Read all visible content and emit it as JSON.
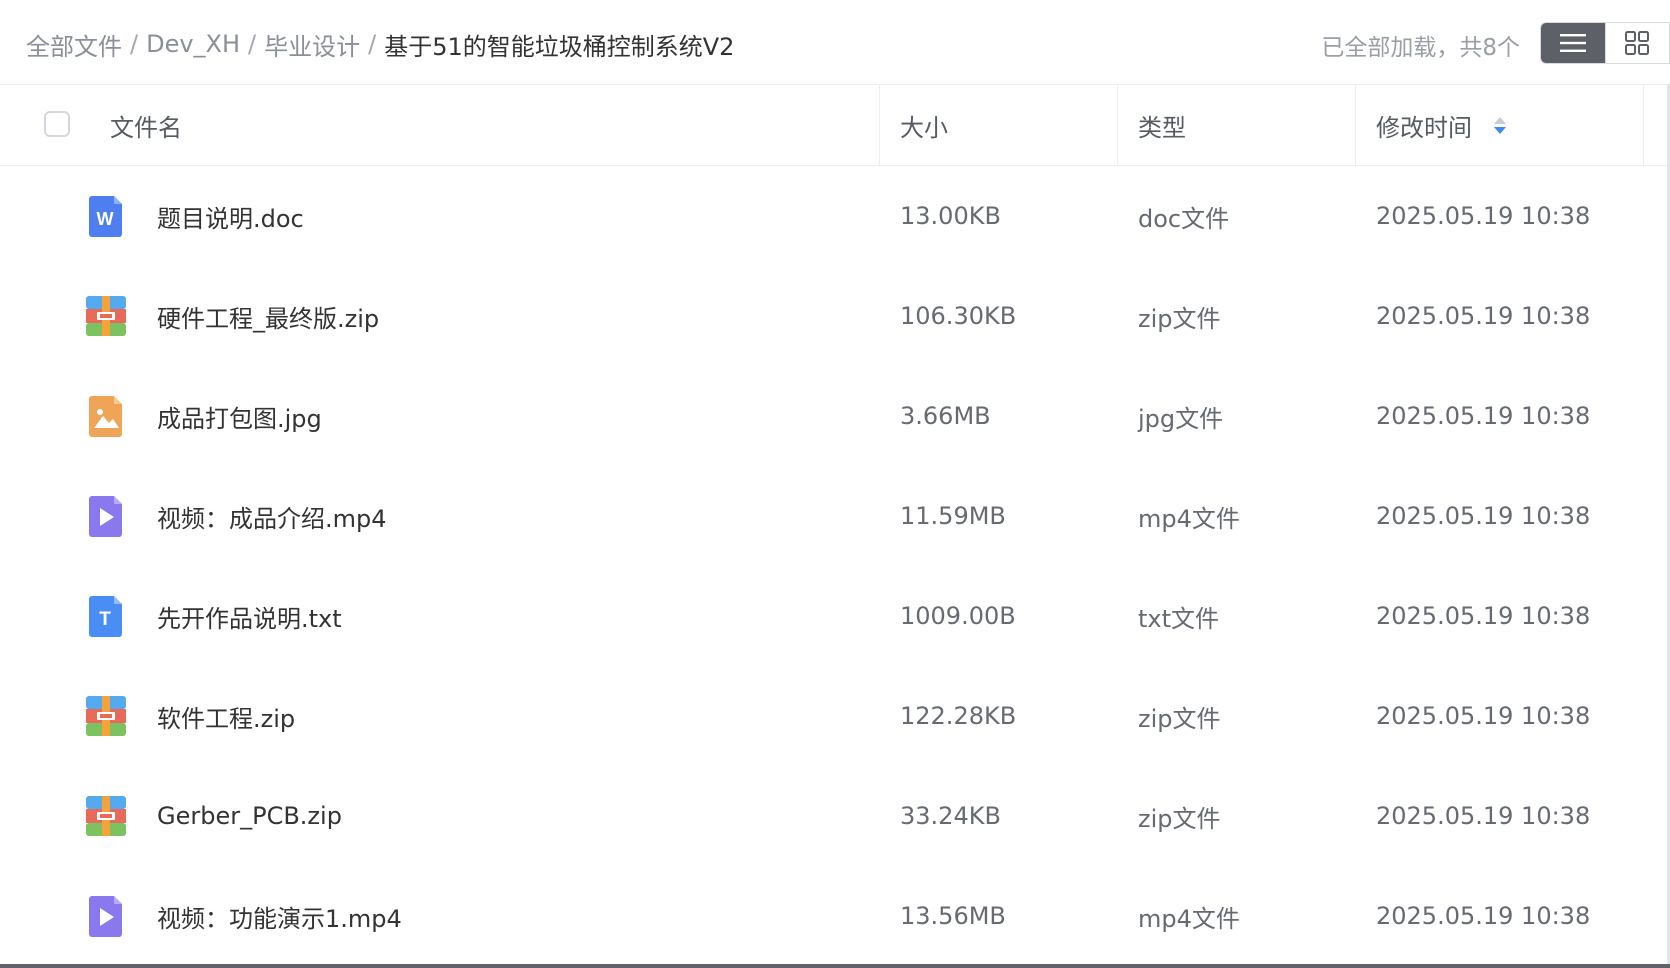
{
  "breadcrumb": {
    "items": [
      "全部文件",
      "Dev_XH",
      "毕业设计"
    ],
    "separator": "/",
    "current": "基于51的智能垃圾桶控制系统V2"
  },
  "status": {
    "loaded_text": "已全部加载，共8个"
  },
  "view_toggle": {
    "list_icon": "list-icon",
    "grid_icon": "grid-icon",
    "active": "list"
  },
  "table": {
    "headers": {
      "name": "文件名",
      "size": "大小",
      "type": "类型",
      "mtime": "修改时间"
    },
    "sort": {
      "column": "mtime",
      "direction": "desc"
    },
    "rows": [
      {
        "name": "题目说明.doc",
        "size": "13.00KB",
        "type": "doc文件",
        "mtime": "2025.05.19 10:38",
        "icon": "word-doc-icon"
      },
      {
        "name": "硬件工程_最终版.zip",
        "size": "106.30KB",
        "type": "zip文件",
        "mtime": "2025.05.19 10:38",
        "icon": "zip-archive-icon"
      },
      {
        "name": "成品打包图.jpg",
        "size": "3.66MB",
        "type": "jpg文件",
        "mtime": "2025.05.19 10:38",
        "icon": "image-file-icon"
      },
      {
        "name": "视频：成品介绍.mp4",
        "size": "11.59MB",
        "type": "mp4文件",
        "mtime": "2025.05.19 10:38",
        "icon": "video-file-icon"
      },
      {
        "name": "先开作品说明.txt",
        "size": "1009.00B",
        "type": "txt文件",
        "mtime": "2025.05.19 10:38",
        "icon": "text-file-icon"
      },
      {
        "name": "软件工程.zip",
        "size": "122.28KB",
        "type": "zip文件",
        "mtime": "2025.05.19 10:38",
        "icon": "zip-archive-icon"
      },
      {
        "name": "Gerber_PCB.zip",
        "size": "33.24KB",
        "type": "zip文件",
        "mtime": "2025.05.19 10:38",
        "icon": "zip-archive-icon"
      },
      {
        "name": "视频：功能演示1.mp4",
        "size": "13.56MB",
        "type": "mp4文件",
        "mtime": "2025.05.19 10:38",
        "icon": "video-file-icon"
      }
    ]
  },
  "colors": {
    "word": "#4f7ef0",
    "zip_top": "#54a9ef",
    "zip_mid": "#e86a5a",
    "zip_bottom": "#7cc25e",
    "zip_strap": "#f4a23c",
    "image": "#f0a457",
    "video": "#8a78ee",
    "text": "#4a8ef5",
    "sort_active": "#3d8bf2",
    "toggle_active": "#5d6066"
  }
}
